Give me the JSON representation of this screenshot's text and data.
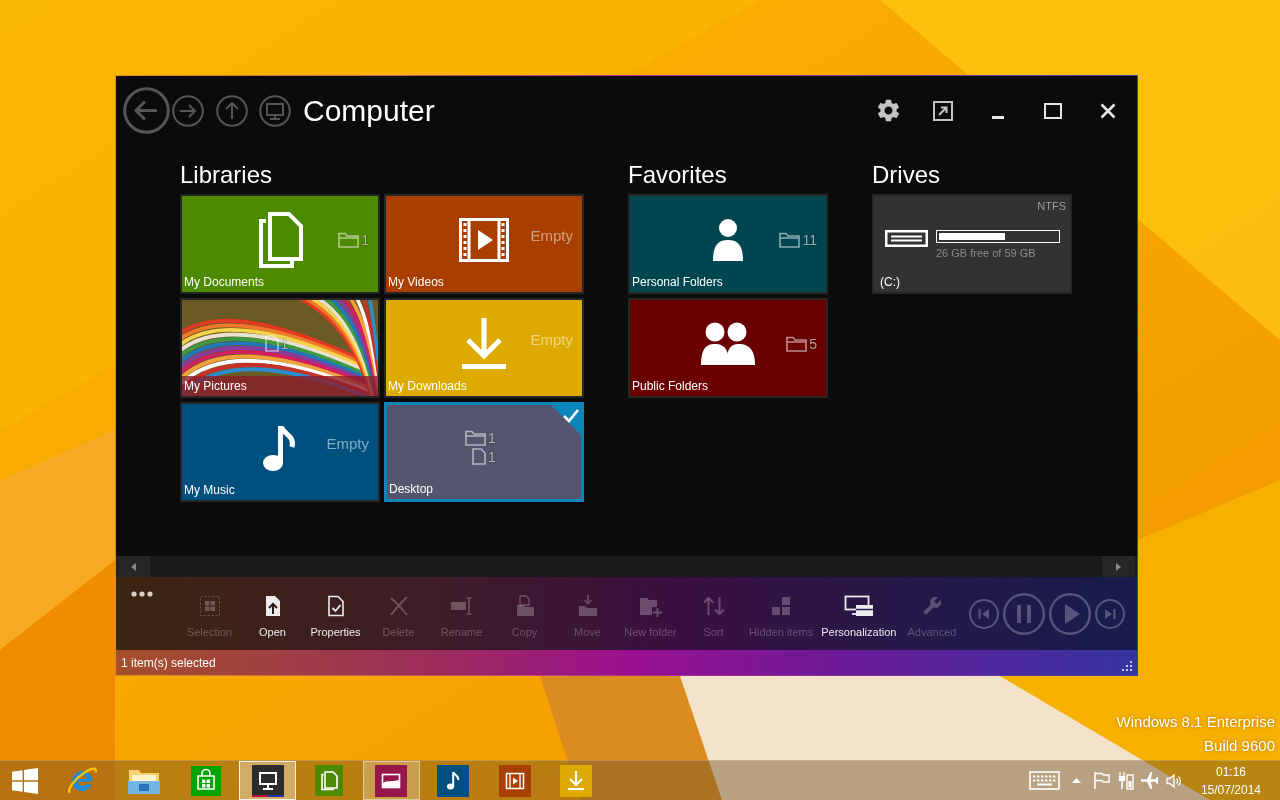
{
  "window": {
    "title": "Computer"
  },
  "sections": [
    {
      "heading": "Libraries",
      "tiles": [
        {
          "label": "My Documents",
          "kind": "documents",
          "color": "#4e8a00",
          "counts": [
            {
              "kind": "folder",
              "value": "1"
            }
          ],
          "selected": false
        },
        {
          "label": "My Videos",
          "kind": "videos",
          "color": "#a83e00",
          "status": "Empty",
          "selected": false
        },
        {
          "label": "My Pictures",
          "kind": "pictures",
          "counts": [
            {
              "kind": "file",
              "value": "1"
            }
          ],
          "selected": false
        },
        {
          "label": "My Downloads",
          "kind": "downloads",
          "color": "#dcaa00",
          "status": "Empty",
          "selected": false
        },
        {
          "label": "My Music",
          "kind": "music",
          "color": "#00507f",
          "status": "Empty",
          "selected": false
        },
        {
          "label": "Desktop",
          "kind": "desktop",
          "color": "#55556f",
          "counts": [
            {
              "kind": "folder",
              "value": "1"
            },
            {
              "kind": "file",
              "value": "1"
            }
          ],
          "selected": true
        }
      ]
    },
    {
      "heading": "Favorites",
      "tiles": [
        {
          "label": "Personal Folders",
          "kind": "person",
          "color": "#004650",
          "counts": [
            {
              "kind": "folder",
              "value": "11"
            }
          ],
          "selected": false
        },
        {
          "label": "Public Folders",
          "kind": "people",
          "color": "#6a0000",
          "counts": [
            {
              "kind": "folder",
              "value": "5"
            }
          ],
          "selected": false
        }
      ]
    },
    {
      "heading": "Drives",
      "drives": [
        {
          "label": "(C:)",
          "filesystem": "NTFS",
          "space": "26 GB free of 59 GB",
          "level": 0.56
        }
      ]
    }
  ],
  "toolbar": {
    "buttons": [
      {
        "label": "Selection",
        "kind": "selection",
        "disabled": true
      },
      {
        "label": "Open",
        "kind": "open",
        "disabled": false
      },
      {
        "label": "Properties",
        "kind": "properties",
        "disabled": false
      },
      {
        "label": "Delete",
        "kind": "delete",
        "disabled": true
      },
      {
        "label": "Rename",
        "kind": "rename",
        "disabled": true
      },
      {
        "label": "Copy",
        "kind": "copy",
        "disabled": true
      },
      {
        "label": "Move",
        "kind": "move",
        "disabled": true
      },
      {
        "label": "New folder",
        "kind": "new_folder",
        "disabled": true
      },
      {
        "label": "Sort",
        "kind": "sort",
        "disabled": true
      },
      {
        "label": "Hidden items",
        "kind": "hidden",
        "disabled": true
      },
      {
        "label": "Personalization",
        "kind": "personalization",
        "disabled": false
      },
      {
        "label": "Advanced",
        "kind": "advanced",
        "disabled": true
      }
    ]
  },
  "status_bar": {
    "text": "1 item(s) selected"
  },
  "desktop": {
    "edition": "Windows 8.1 Enterprise",
    "build": "Build 9600"
  },
  "taskbar": {
    "apps": [
      {
        "kind": "start",
        "highlighted": false,
        "focused": false
      },
      {
        "kind": "browser",
        "highlighted": false,
        "focused": false
      },
      {
        "kind": "files",
        "highlighted": false,
        "focused": false
      },
      {
        "kind": "store",
        "highlighted": false,
        "focused": false
      },
      {
        "kind": "computer",
        "highlighted": true,
        "focused": true
      },
      {
        "kind": "documents",
        "highlighted": false,
        "focused": false
      },
      {
        "kind": "pictures",
        "highlighted": true,
        "focused": false
      },
      {
        "kind": "music",
        "highlighted": false,
        "focused": false
      },
      {
        "kind": "videos",
        "highlighted": false,
        "focused": false
      },
      {
        "kind": "downloads",
        "highlighted": false,
        "focused": false
      }
    ],
    "clock": {
      "time": "01:16",
      "date": "15/07/2014"
    }
  }
}
